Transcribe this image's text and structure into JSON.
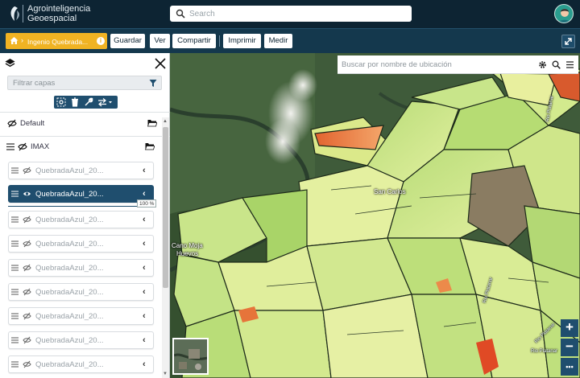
{
  "app": {
    "brand_line1": "Agrointeligencia",
    "brand_line2": "Geoespacial",
    "search_placeholder": "Search"
  },
  "toolbar": {
    "breadcrumb": "Ingenio Quebrada...",
    "buttons": [
      "Guardar",
      "Ver",
      "Compartir",
      "Imprimir",
      "Medir"
    ]
  },
  "layers_panel": {
    "filter_placeholder": "Filtrar capas",
    "groups": [
      {
        "label": "Default"
      },
      {
        "label": "IMAX"
      }
    ],
    "layers": [
      {
        "label": "QuebradaAzul_20...",
        "active": false
      },
      {
        "label": "QuebradaAzul_20...",
        "active": true
      },
      {
        "label": "QuebradaAzul_20...",
        "active": false
      },
      {
        "label": "QuebradaAzul_20...",
        "active": false
      },
      {
        "label": "QuebradaAzul_20...",
        "active": false
      },
      {
        "label": "QuebradaAzul_20...",
        "active": false
      },
      {
        "label": "QuebradaAzul_20...",
        "active": false
      },
      {
        "label": "QuebradaAzul_20...",
        "active": false
      },
      {
        "label": "QuebradaAzul_20...",
        "active": false
      }
    ],
    "opacity_label": "100 %",
    "opacity": 1.0
  },
  "map": {
    "search_placeholder": "Buscar por nombre de ubicación",
    "labels": {
      "san_carlos": "San Carlos",
      "cano_moja_1": "Cano Moja",
      "cano_moja_2": "Huevos",
      "rio_platanar_1": "Rio Platanar",
      "rio_platanar_2": "Rio Platanar",
      "rio_platanar_3": "Rio Platanar",
      "rio_platanar_4": "Rio Platanar"
    },
    "zoom_in": "+",
    "zoom_out": "−",
    "more": "•••"
  },
  "colors": {
    "header_bg": "#0d2433",
    "toolbar_bg": "#14384d",
    "accent_yellow": "#f0b323",
    "active_layer": "#1f4e6e"
  }
}
